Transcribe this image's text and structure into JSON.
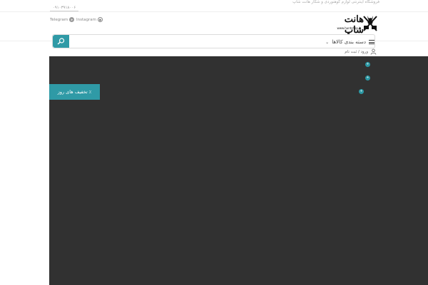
{
  "header": {
    "tagline": "فروشگاه اینترنتی لوازم کوهنوردی و شکار هانت شاپ",
    "phone": "۰۹۱۰۳۹۱۸۰۰۶",
    "social": {
      "telegram": "Telegram",
      "instagram": "Instagram"
    },
    "logo": {
      "title": "هانت شاپ",
      "url": "www.huntshop.ir"
    }
  },
  "search": {
    "placeholder": "",
    "button_icon": "search-icon"
  },
  "categories": {
    "label": "دسته بندی کالاها"
  },
  "account": {
    "login_label": "ورود / ثبت نام"
  },
  "hero": {
    "promo_label": "٪ تخفیف های روز",
    "dots": [
      "+",
      "+",
      "+"
    ],
    "background": "#313131",
    "accent": "#2f9aa6"
  }
}
